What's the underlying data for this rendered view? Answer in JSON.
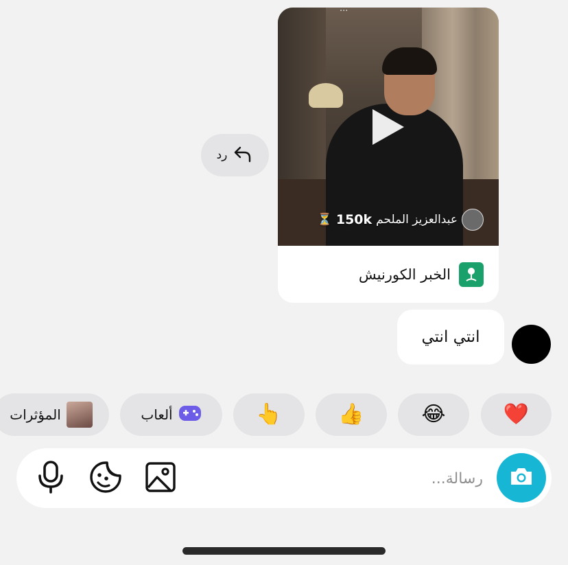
{
  "reply": {
    "label": "رد",
    "icon": "reply-arrow-icon"
  },
  "shared_video": {
    "top_caption": "...",
    "author_name": "عبدالعزيز الملحم",
    "views": "150k",
    "hourglass": "⏳",
    "place_name": "الخبر الكورنيش",
    "place_icon": "location-pin-icon"
  },
  "message": {
    "text": "انتي انتي"
  },
  "quick_reactions": [
    {
      "name": "heart",
      "emoji": "❤️"
    },
    {
      "name": "laughing",
      "emoji": "😂"
    },
    {
      "name": "thumbs-up",
      "emoji": "👍"
    },
    {
      "name": "pointing-hand",
      "emoji": "👆"
    },
    {
      "name": "games",
      "label": "ألعاب",
      "icon": "gamepad-icon"
    },
    {
      "name": "effects",
      "label": "المؤثرات",
      "icon": "effects-thumbnail"
    }
  ],
  "compose": {
    "placeholder": "رسالة...",
    "value": "",
    "camera_icon": "camera-icon",
    "gallery_icon": "image-icon",
    "sticker_icon": "sticker-icon",
    "mic_icon": "microphone-icon"
  },
  "colors": {
    "accent_camera": "#17b6d4",
    "place_icon_bg": "#1aa06a",
    "games_icon": "#6c5ce7",
    "background": "#f2f2f2",
    "chip_bg": "#e4e4e6"
  }
}
